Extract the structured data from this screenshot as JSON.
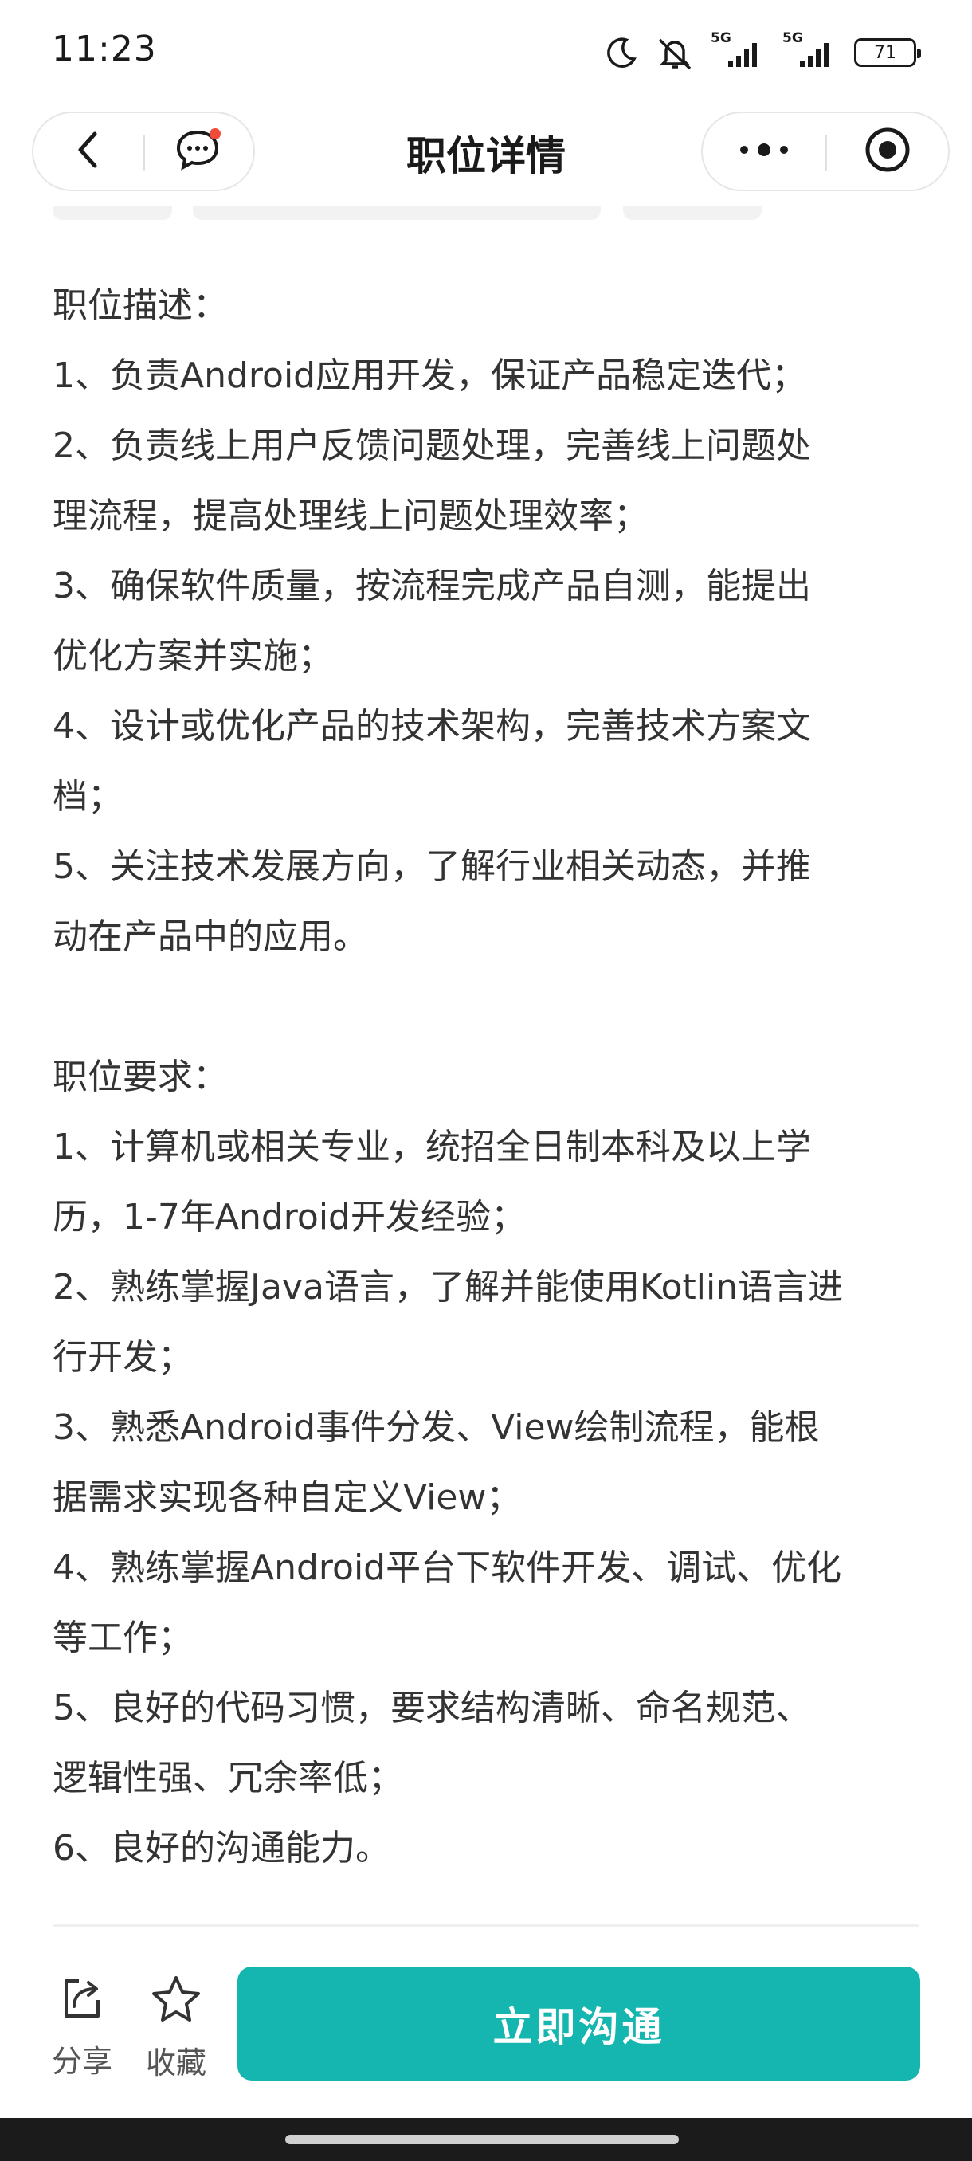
{
  "status_bar": {
    "time": "11:23",
    "network_1": "5G",
    "network_2": "5G",
    "battery": "71"
  },
  "header": {
    "title": "职位详情",
    "back_icon": "chevron-left-icon",
    "message_icon": "chat-bubble-icon",
    "more_icon": "more-dots-icon",
    "close_icon": "target-close-icon"
  },
  "description": {
    "title": "职位描述：",
    "lines": [
      "1、负责Android应用开发，保证产品稳定迭代；",
      "2、负责线上用户反馈问题处理，完善线上问题处",
      "理流程，提高处理线上问题处理效率；",
      "3、确保软件质量，按流程完成产品自测，能提出",
      "优化方案并实施；",
      "4、设计或优化产品的技术架构，完善技术方案文",
      "档；",
      "5、关注技术发展方向，了解行业相关动态，并推",
      "动在产品中的应用。"
    ]
  },
  "requirements": {
    "title": "职位要求：",
    "lines": [
      "1、计算机或相关专业，统招全日制本科及以上学",
      "历，1-7年Android开发经验；",
      "2、熟练掌握Java语言，了解并能使用Kotlin语言进",
      "行开发；",
      "3、熟悉Android事件分发、View绘制流程，能根",
      "据需求实现各种自定义View；",
      "4、熟练掌握Android平台下软件开发、调试、优化",
      "等工作；",
      "5、良好的代码习惯，要求结构清晰、命名规范、",
      "逻辑性强、冗余率低；",
      "6、良好的沟通能力。"
    ]
  },
  "bottom": {
    "share_label": "分享",
    "favorite_label": "收藏",
    "chat_label": "立即沟通",
    "accent_color": "#16b6b0"
  }
}
